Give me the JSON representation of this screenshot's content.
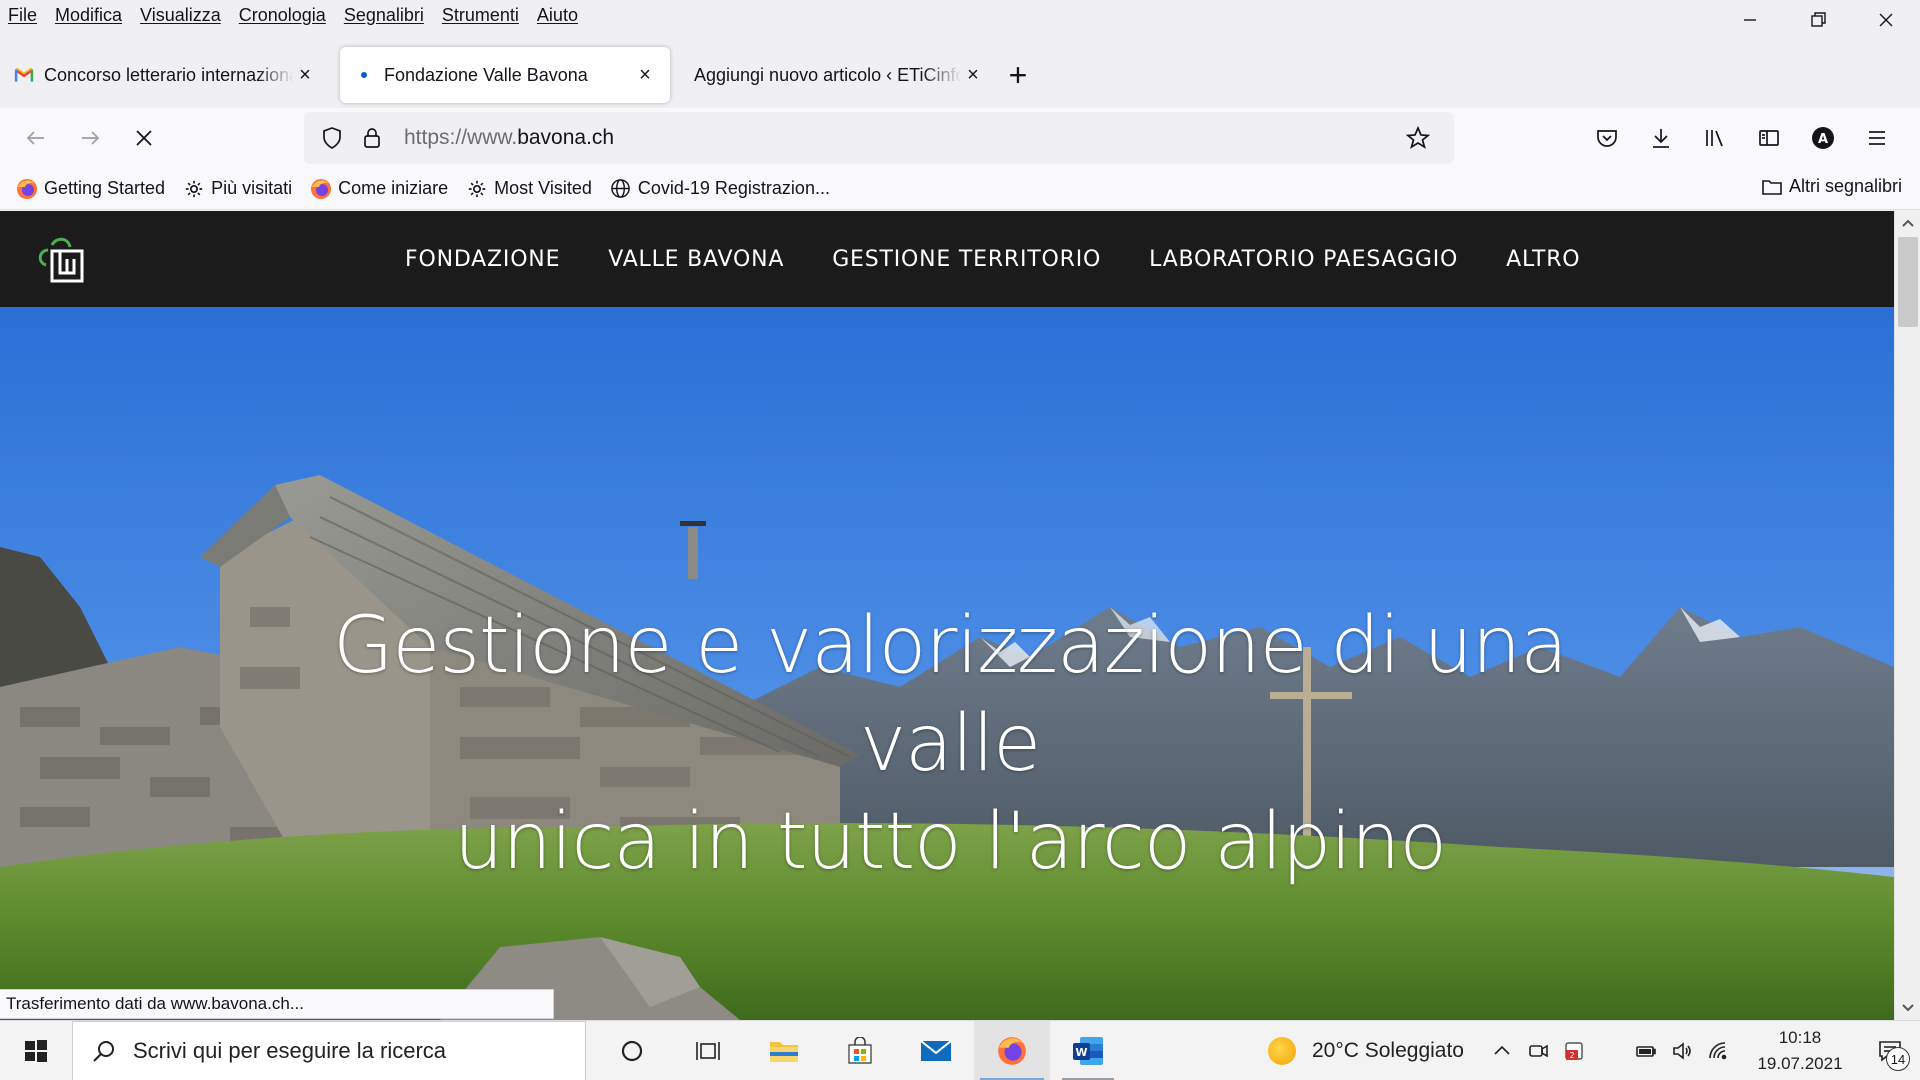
{
  "menu": {
    "items": [
      "File",
      "Modifica",
      "Visualizza",
      "Cronologia",
      "Segnalibri",
      "Strumenti",
      "Aiuto"
    ]
  },
  "tabs": [
    {
      "title": "Concorso letterario internazionale",
      "favicon": "gmail-icon",
      "active": false
    },
    {
      "title": "Fondazione Valle Bavona",
      "favicon": "loading-dot-icon",
      "active": true
    },
    {
      "title": "Aggiungi nuovo articolo ‹ ETiCinforma",
      "favicon": "none",
      "active": false
    }
  ],
  "urlbar": {
    "scheme": "https://www.",
    "domain": "bavona.ch"
  },
  "bookmarks": {
    "items": [
      {
        "label": "Getting Started",
        "icon": "firefox-icon"
      },
      {
        "label": "Più visitati",
        "icon": "gear-icon"
      },
      {
        "label": "Come iniziare",
        "icon": "firefox-icon"
      },
      {
        "label": "Most Visited",
        "icon": "gear-icon"
      },
      {
        "label": "Covid-19 Registrazion...",
        "icon": "globe-icon"
      }
    ],
    "other": "Altri segnalibri"
  },
  "site": {
    "nav": [
      "FONDAZIONE",
      "VALLE BAVONA",
      "GESTIONE TERRITORIO",
      "LABORATORIO PAESAGGIO",
      "ALTRO"
    ],
    "hero_line1": "Gestione e valorizzazione di una valle",
    "hero_line2": "unica in tutto l'arco alpino",
    "header_color": "#1b1b1b",
    "logo_color": "#4caf50"
  },
  "status": {
    "text": "Trasferimento dati da www.bavona.ch..."
  },
  "taskbar": {
    "search_placeholder": "Scrivi qui per eseguire la ricerca",
    "weather": "20°C  Soleggiato",
    "time": "10:18",
    "date": "19.07.2021",
    "notifications": "14"
  }
}
